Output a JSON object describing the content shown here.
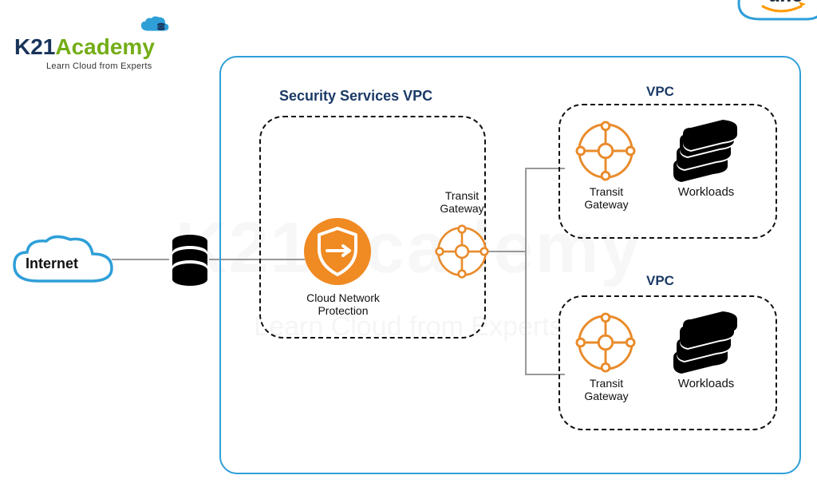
{
  "logo": {
    "brand_k": "K21",
    "brand_rest": "Academy",
    "tagline": "Learn Cloud from Experts"
  },
  "watermark": {
    "main": "K21Academy",
    "sub": "Learn Cloud from Experts"
  },
  "aws_label": "aws",
  "internet_label": "Internet",
  "security_vpc": {
    "title": "Security Services VPC",
    "cnp_label": "Cloud Network Protection",
    "tg_label": "Transit Gateway"
  },
  "vpc1": {
    "title": "VPC",
    "tg_label": "Transit Gateway",
    "workloads_label": "Workloads"
  },
  "vpc2": {
    "title": "VPC",
    "tg_label": "Transit Gateway",
    "workloads_label": "Workloads"
  },
  "colors": {
    "border_blue": "#2f9fd8",
    "title_navy": "#1b3a66",
    "orange": "#e98b2b",
    "cnp_fill": "#f08a23",
    "black": "#111111",
    "logo_green": "#74ad17",
    "logo_navy": "#19335a",
    "aws_smile": "#ff9900"
  }
}
